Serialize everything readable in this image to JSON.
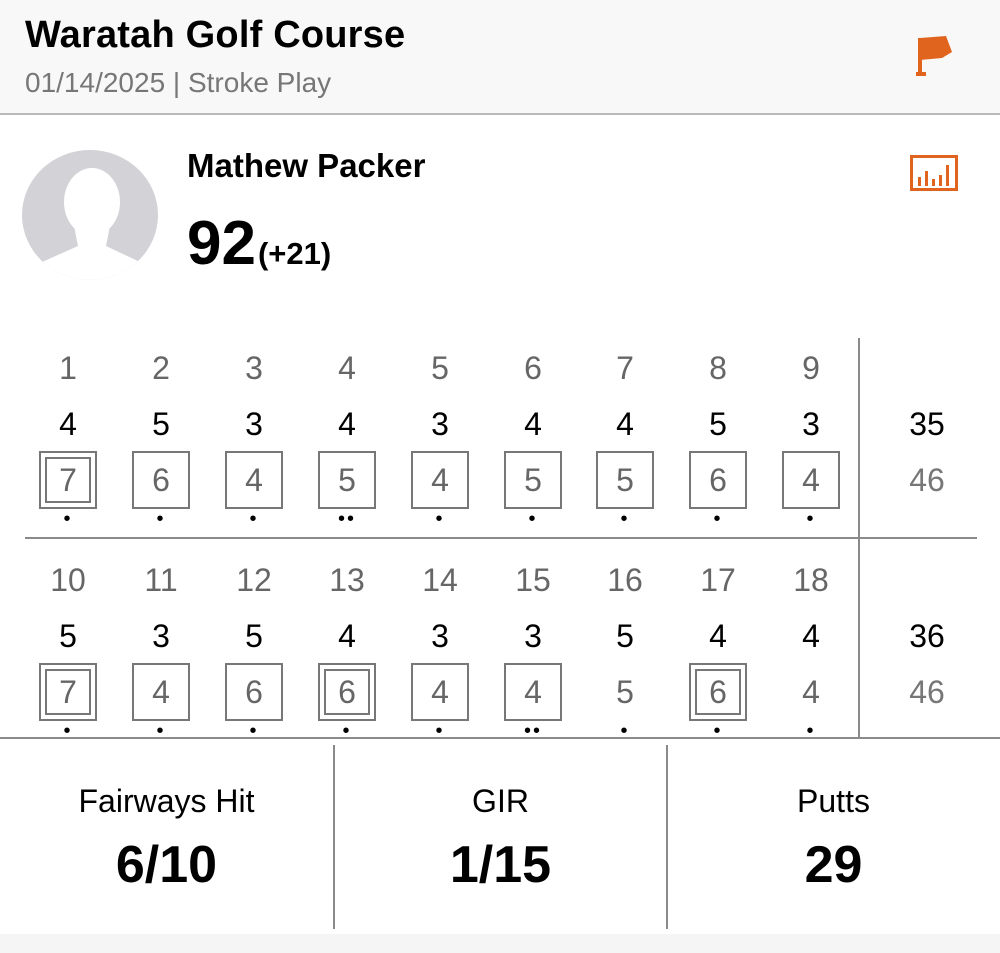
{
  "header": {
    "course": "Waratah Golf Course",
    "round_info": "01/14/2025 | Stroke Play",
    "flag_icon": "flag-icon",
    "accent": "#e0641e"
  },
  "player": {
    "name": "Mathew Packer",
    "total": "92",
    "to_par": "(+21)",
    "avatar_icon": "person-silhouette-icon",
    "stats_icon": "bar-chart-icon"
  },
  "front": {
    "holes": [
      "1",
      "2",
      "3",
      "4",
      "5",
      "6",
      "7",
      "8",
      "9"
    ],
    "pars": [
      "4",
      "5",
      "3",
      "4",
      "3",
      "4",
      "4",
      "5",
      "3"
    ],
    "scores": [
      "7",
      "6",
      "4",
      "5",
      "4",
      "5",
      "5",
      "6",
      "4"
    ],
    "putts": [
      1,
      1,
      1,
      2,
      1,
      1,
      1,
      1,
      1
    ],
    "par_total": "35",
    "score_total": "46"
  },
  "back": {
    "holes": [
      "10",
      "11",
      "12",
      "13",
      "14",
      "15",
      "16",
      "17",
      "18"
    ],
    "pars": [
      "5",
      "3",
      "5",
      "4",
      "3",
      "3",
      "5",
      "4",
      "4"
    ],
    "scores": [
      "7",
      "4",
      "6",
      "6",
      "4",
      "4",
      "5",
      "6",
      "4"
    ],
    "putts": [
      1,
      1,
      1,
      1,
      1,
      2,
      1,
      1,
      1
    ],
    "par_total": "36",
    "score_total": "46"
  },
  "stats": {
    "fairways_label": "Fairways Hit",
    "fairways_value": "6/10",
    "gir_label": "GIR",
    "gir_value": "1/15",
    "putts_label": "Putts",
    "putts_value": "29"
  }
}
